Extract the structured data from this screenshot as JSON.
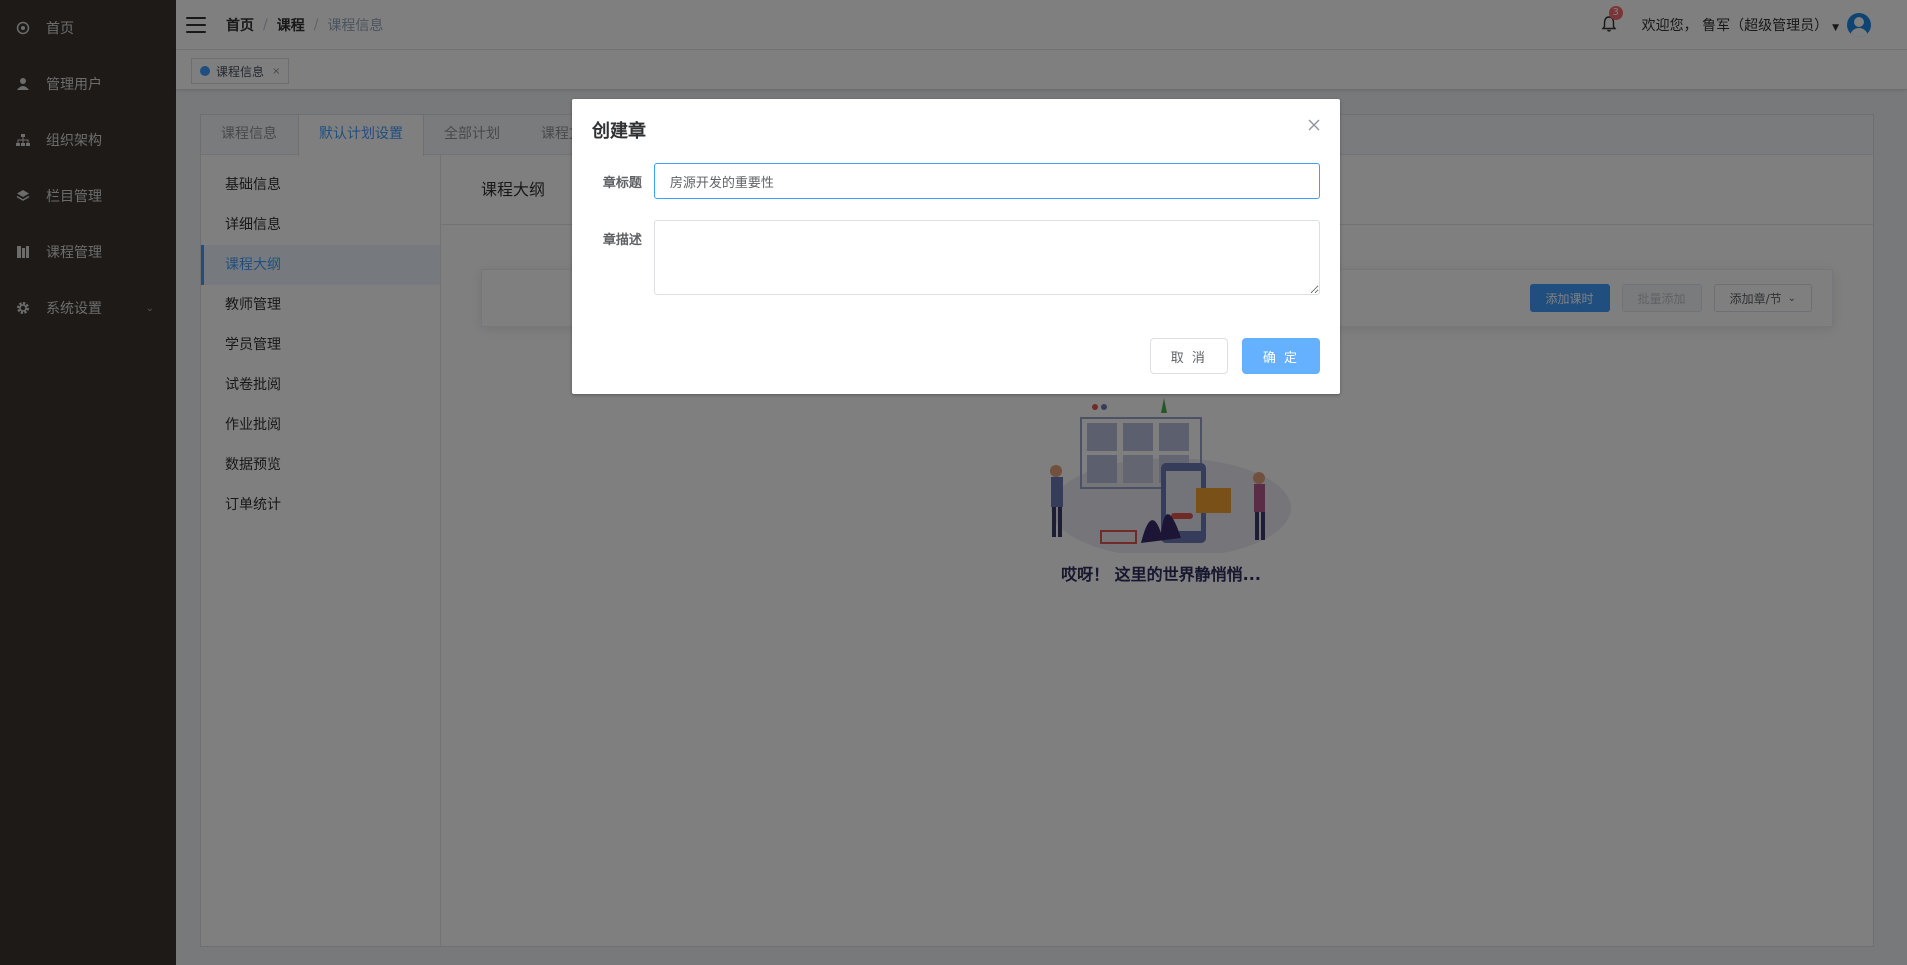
{
  "sidebar": {
    "items": [
      {
        "label": "首页",
        "icon": "dashboard-icon"
      },
      {
        "label": "管理用户",
        "icon": "user-icon"
      },
      {
        "label": "组织架构",
        "icon": "org-tree-icon"
      },
      {
        "label": "栏目管理",
        "icon": "layers-icon"
      },
      {
        "label": "课程管理",
        "icon": "book-icon"
      },
      {
        "label": "系统设置",
        "icon": "gear-icon"
      }
    ]
  },
  "header": {
    "breadcrumb": [
      "首页",
      "课程",
      "课程信息"
    ],
    "breadcrumb_sep": "/",
    "notification_count": "3",
    "welcome": "欢迎您，  鲁军（超级管理员）"
  },
  "tagbar": {
    "tag_label": "课程信息",
    "close": "×"
  },
  "tabs": [
    "课程信息",
    "默认计划设置",
    "全部计划",
    "课程文"
  ],
  "inner_menu": [
    "基础信息",
    "详细信息",
    "课程大纲",
    "教师管理",
    "学员管理",
    "试卷批阅",
    "作业批阅",
    "数据预览",
    "订单统计"
  ],
  "content": {
    "title": "课程大纲",
    "buttons": {
      "add_lesson": "添加课时",
      "batch_add": "批量添加",
      "add_chapter": "添加章/节"
    },
    "empty_text": "哎呀！  这里的世界静悄悄..."
  },
  "dialog": {
    "title": "创建章",
    "title_label": "章标题",
    "title_value": "房源开发的重要性",
    "desc_label": "章描述",
    "desc_value": "",
    "cancel": "取 消",
    "confirm": "确 定"
  },
  "colors": {
    "primary": "#409eff",
    "sidebar_bg": "#3b342e",
    "badge": "#f56c6c"
  }
}
